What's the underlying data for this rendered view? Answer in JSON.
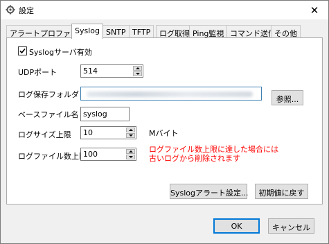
{
  "window": {
    "title": "設定",
    "close_glyph": "✕"
  },
  "tabs": [
    {
      "label": "アラートプロファイル",
      "active": false
    },
    {
      "label": "Syslog",
      "active": true
    },
    {
      "label": "SNTP",
      "active": false
    },
    {
      "label": "TFTP",
      "active": false
    },
    {
      "label": "ログ取得",
      "active": false
    },
    {
      "label": "Ping監視",
      "active": false
    },
    {
      "label": "コマンド送信",
      "active": false
    },
    {
      "label": "その他",
      "active": false
    }
  ],
  "syslog": {
    "enable_label": "Syslogサーバ有効",
    "enable_checked": true,
    "udp_port_label": "UDPポート",
    "udp_port_value": "514",
    "log_folder_label": "ログ保存フォルダ",
    "browse_label": "参照...",
    "base_filename_label": "ベースファイル名",
    "base_filename_value": "syslog",
    "log_size_label": "ログサイズ上限",
    "log_size_value": "10",
    "log_size_unit": "Mバイト",
    "log_count_label": "ログファイル数上限",
    "log_count_value": "100",
    "warning_line1": "ログファイル数上限に達した場合には",
    "warning_line2": "古いログから削除されます",
    "alert_settings_label": "Syslogアラート設定...",
    "reset_label": "初期値に戻す"
  },
  "footer": {
    "ok_label": "OK",
    "cancel_label": "キャンセル"
  },
  "colors": {
    "warning": "#ff0000",
    "accent": "#0078d7"
  }
}
